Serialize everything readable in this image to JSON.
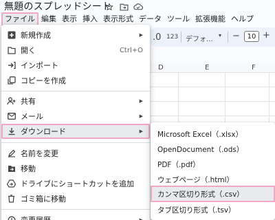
{
  "window": {
    "title": "無題のスプレッドシート"
  },
  "menubar": [
    {
      "label": "ファイル"
    },
    {
      "label": "編集"
    },
    {
      "label": "表示"
    },
    {
      "label": "挿入"
    },
    {
      "label": "表示形式"
    },
    {
      "label": "データ"
    },
    {
      "label": "ツール"
    },
    {
      "label": "拡張機能"
    },
    {
      "label": "ヘルプ"
    }
  ],
  "toolbar": {
    "number_format": "123",
    "font_name": "デフォ...",
    "font_size": "10",
    "minus": "−",
    "plus": "+"
  },
  "columns": [
    "D",
    "E",
    "F"
  ],
  "file_menu": {
    "items": [
      {
        "label": "新規作成",
        "icon": "plus-box-icon",
        "submenu": true
      },
      {
        "label": "開く",
        "icon": "folder-icon",
        "shortcut": "Ctrl+O"
      },
      {
        "label": "インポート",
        "icon": "import-icon"
      },
      {
        "label": "コピーを作成",
        "icon": "copy-icon"
      },
      {
        "label": "共有",
        "icon": "share-person-icon",
        "submenu": true
      },
      {
        "label": "メール",
        "icon": "mail-icon",
        "submenu": true
      },
      {
        "label": "ダウンロード",
        "icon": "download-icon",
        "submenu": true
      },
      {
        "label": "名前を変更",
        "icon": "rename-icon"
      },
      {
        "label": "移動",
        "icon": "move-folder-icon"
      },
      {
        "label": "ドライブにショートカットを追加",
        "icon": "drive-shortcut-icon"
      },
      {
        "label": "ゴミ箱に移動",
        "icon": "trash-icon"
      },
      {
        "label": "変更履歴",
        "icon": "history-icon",
        "submenu": true
      }
    ]
  },
  "download_menu": {
    "items": [
      {
        "label": "Microsoft Excel（.xlsx）"
      },
      {
        "label": "OpenDocument（.ods）"
      },
      {
        "label": "PDF（.pdf）"
      },
      {
        "label": "ウェブページ（.html）"
      },
      {
        "label": "カンマ区切り形式（.csv）"
      },
      {
        "label": "タブ区切り形式（.tsv）"
      }
    ]
  },
  "colors": {
    "highlight": "#f4a6c6",
    "hover": "#e8eaed"
  }
}
